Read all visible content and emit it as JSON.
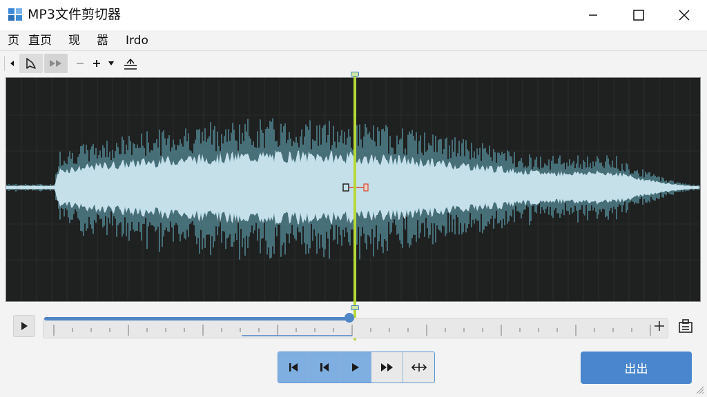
{
  "window": {
    "title": "MP3文件剪切器",
    "colors": {
      "accent": "#4a86cd",
      "waveform": "#c6e0ea",
      "waveform_edge": "#5c9aa8",
      "playhead": "#b6d93a",
      "panel_bg": "#1f2020"
    }
  },
  "menu": {
    "items": [
      {
        "label": "页"
      },
      {
        "label": "直页"
      },
      {
        "label": "现"
      },
      {
        "label": "嚣"
      },
      {
        "label": "Irdo"
      }
    ]
  },
  "toolbar": {
    "icons": [
      "caret-left-icon",
      "select-tool-icon",
      "fast-forward-icon",
      "minus-icon",
      "plus-icon",
      "dropdown-arrow-icon",
      "trim-icon"
    ]
  },
  "timeline": {
    "progress_fraction": 0.49,
    "icons": [
      "play-icon",
      "zoom-in-icon",
      "fit-icon"
    ]
  },
  "transport": {
    "icons": [
      "skip-to-start-icon",
      "step-back-icon",
      "play-icon",
      "fast-forward-icon",
      "expand-horizontal-icon"
    ]
  },
  "export": {
    "label": "出出"
  }
}
